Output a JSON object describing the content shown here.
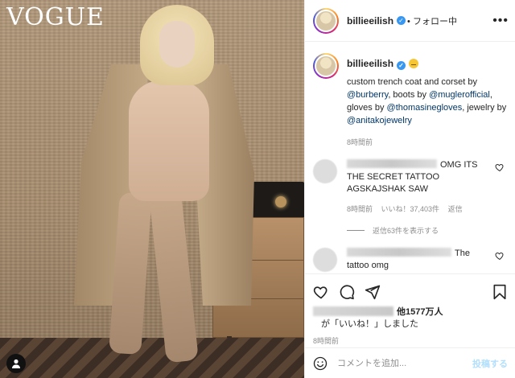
{
  "photo": {
    "masthead": "VOGUE"
  },
  "header": {
    "username": "billieeilish",
    "follow_state": "• フォロー中",
    "more": "•••"
  },
  "caption": {
    "username": "billieeilish",
    "text_parts": [
      "custom trench coat and corset by ",
      "@burberry",
      ", boots by ",
      "@muglerofficial",
      ", gloves by ",
      "@thomasinegloves",
      ", jewelry by ",
      "@anitakojewelry"
    ],
    "time_ago": "8時間前"
  },
  "comments": [
    {
      "text": "OMG ITS THE SECRET TATTOO AGSKAJSHAK SAW",
      "time": "8時間前",
      "likes": "いいね！37,403件",
      "reply": "返信",
      "view_replies": "返信63件を表示する"
    },
    {
      "text": "The tattoo omg"
    }
  ],
  "actions": {
    "likes_suffix": "他1577万人",
    "likes_line2": "が「いいね！」しました",
    "post_time": "8時間前"
  },
  "comment_box": {
    "placeholder": "コメントを追加...",
    "post_label": "投稿する"
  },
  "icons": [
    "verified-badge-icon",
    "more-options-icon",
    "heart-icon",
    "comment-icon",
    "share-icon",
    "bookmark-icon",
    "emoji-icon",
    "user-icon"
  ],
  "colors": {
    "link": "#00376b",
    "verified": "#3897f0",
    "muted": "#8e8e8e",
    "post_button": "#b2dffc"
  }
}
